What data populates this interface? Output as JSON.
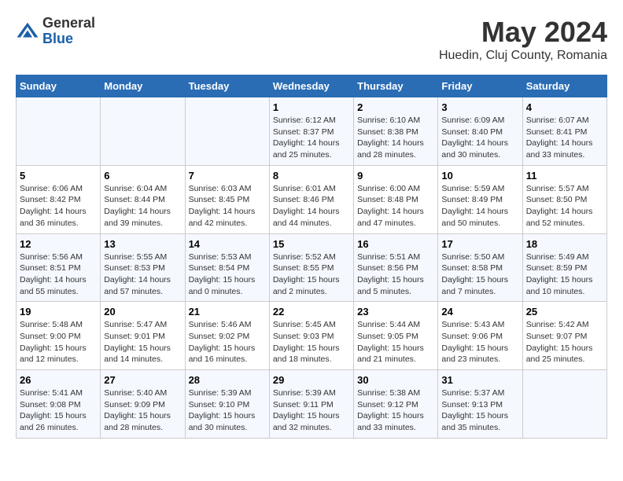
{
  "header": {
    "logo_general": "General",
    "logo_blue": "Blue",
    "title": "May 2024",
    "subtitle": "Huedin, Cluj County, Romania"
  },
  "weekdays": [
    "Sunday",
    "Monday",
    "Tuesday",
    "Wednesday",
    "Thursday",
    "Friday",
    "Saturday"
  ],
  "weeks": [
    [
      {
        "day": "",
        "detail": ""
      },
      {
        "day": "",
        "detail": ""
      },
      {
        "day": "",
        "detail": ""
      },
      {
        "day": "1",
        "detail": "Sunrise: 6:12 AM\nSunset: 8:37 PM\nDaylight: 14 hours\nand 25 minutes."
      },
      {
        "day": "2",
        "detail": "Sunrise: 6:10 AM\nSunset: 8:38 PM\nDaylight: 14 hours\nand 28 minutes."
      },
      {
        "day": "3",
        "detail": "Sunrise: 6:09 AM\nSunset: 8:40 PM\nDaylight: 14 hours\nand 30 minutes."
      },
      {
        "day": "4",
        "detail": "Sunrise: 6:07 AM\nSunset: 8:41 PM\nDaylight: 14 hours\nand 33 minutes."
      }
    ],
    [
      {
        "day": "5",
        "detail": "Sunrise: 6:06 AM\nSunset: 8:42 PM\nDaylight: 14 hours\nand 36 minutes."
      },
      {
        "day": "6",
        "detail": "Sunrise: 6:04 AM\nSunset: 8:44 PM\nDaylight: 14 hours\nand 39 minutes."
      },
      {
        "day": "7",
        "detail": "Sunrise: 6:03 AM\nSunset: 8:45 PM\nDaylight: 14 hours\nand 42 minutes."
      },
      {
        "day": "8",
        "detail": "Sunrise: 6:01 AM\nSunset: 8:46 PM\nDaylight: 14 hours\nand 44 minutes."
      },
      {
        "day": "9",
        "detail": "Sunrise: 6:00 AM\nSunset: 8:48 PM\nDaylight: 14 hours\nand 47 minutes."
      },
      {
        "day": "10",
        "detail": "Sunrise: 5:59 AM\nSunset: 8:49 PM\nDaylight: 14 hours\nand 50 minutes."
      },
      {
        "day": "11",
        "detail": "Sunrise: 5:57 AM\nSunset: 8:50 PM\nDaylight: 14 hours\nand 52 minutes."
      }
    ],
    [
      {
        "day": "12",
        "detail": "Sunrise: 5:56 AM\nSunset: 8:51 PM\nDaylight: 14 hours\nand 55 minutes."
      },
      {
        "day": "13",
        "detail": "Sunrise: 5:55 AM\nSunset: 8:53 PM\nDaylight: 14 hours\nand 57 minutes."
      },
      {
        "day": "14",
        "detail": "Sunrise: 5:53 AM\nSunset: 8:54 PM\nDaylight: 15 hours\nand 0 minutes."
      },
      {
        "day": "15",
        "detail": "Sunrise: 5:52 AM\nSunset: 8:55 PM\nDaylight: 15 hours\nand 2 minutes."
      },
      {
        "day": "16",
        "detail": "Sunrise: 5:51 AM\nSunset: 8:56 PM\nDaylight: 15 hours\nand 5 minutes."
      },
      {
        "day": "17",
        "detail": "Sunrise: 5:50 AM\nSunset: 8:58 PM\nDaylight: 15 hours\nand 7 minutes."
      },
      {
        "day": "18",
        "detail": "Sunrise: 5:49 AM\nSunset: 8:59 PM\nDaylight: 15 hours\nand 10 minutes."
      }
    ],
    [
      {
        "day": "19",
        "detail": "Sunrise: 5:48 AM\nSunset: 9:00 PM\nDaylight: 15 hours\nand 12 minutes."
      },
      {
        "day": "20",
        "detail": "Sunrise: 5:47 AM\nSunset: 9:01 PM\nDaylight: 15 hours\nand 14 minutes."
      },
      {
        "day": "21",
        "detail": "Sunrise: 5:46 AM\nSunset: 9:02 PM\nDaylight: 15 hours\nand 16 minutes."
      },
      {
        "day": "22",
        "detail": "Sunrise: 5:45 AM\nSunset: 9:03 PM\nDaylight: 15 hours\nand 18 minutes."
      },
      {
        "day": "23",
        "detail": "Sunrise: 5:44 AM\nSunset: 9:05 PM\nDaylight: 15 hours\nand 21 minutes."
      },
      {
        "day": "24",
        "detail": "Sunrise: 5:43 AM\nSunset: 9:06 PM\nDaylight: 15 hours\nand 23 minutes."
      },
      {
        "day": "25",
        "detail": "Sunrise: 5:42 AM\nSunset: 9:07 PM\nDaylight: 15 hours\nand 25 minutes."
      }
    ],
    [
      {
        "day": "26",
        "detail": "Sunrise: 5:41 AM\nSunset: 9:08 PM\nDaylight: 15 hours\nand 26 minutes."
      },
      {
        "day": "27",
        "detail": "Sunrise: 5:40 AM\nSunset: 9:09 PM\nDaylight: 15 hours\nand 28 minutes."
      },
      {
        "day": "28",
        "detail": "Sunrise: 5:39 AM\nSunset: 9:10 PM\nDaylight: 15 hours\nand 30 minutes."
      },
      {
        "day": "29",
        "detail": "Sunrise: 5:39 AM\nSunset: 9:11 PM\nDaylight: 15 hours\nand 32 minutes."
      },
      {
        "day": "30",
        "detail": "Sunrise: 5:38 AM\nSunset: 9:12 PM\nDaylight: 15 hours\nand 33 minutes."
      },
      {
        "day": "31",
        "detail": "Sunrise: 5:37 AM\nSunset: 9:13 PM\nDaylight: 15 hours\nand 35 minutes."
      },
      {
        "day": "",
        "detail": ""
      }
    ]
  ]
}
